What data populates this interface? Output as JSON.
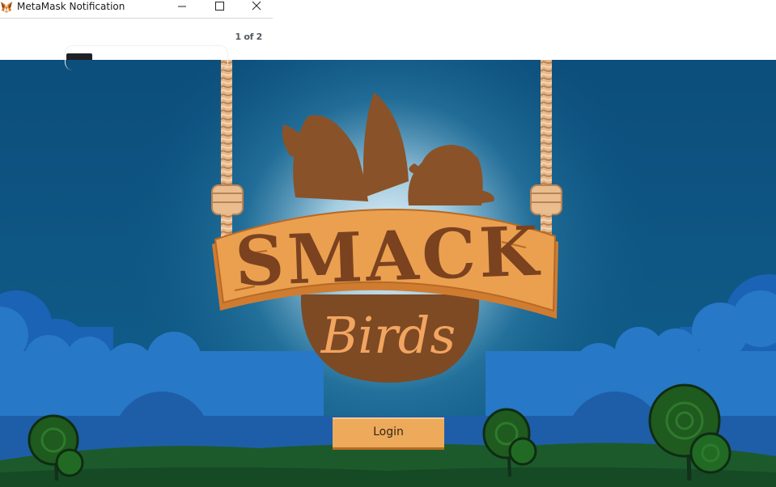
{
  "metamask_window": {
    "title": "MetaMask Notification",
    "counter": "1 of 2",
    "icon": "metamask-fox-icon",
    "controls": [
      "minimize-icon",
      "maximize-icon",
      "close-icon"
    ]
  },
  "game": {
    "title_top": "SMACK",
    "title_bottom": "Birds",
    "login_label": "Login",
    "colors": {
      "sky": "#0f5683",
      "sign_orange": "#e8984a",
      "sign_brown": "#8a4f24",
      "clouds": "#1e61b0",
      "hills": "#1d5b2c"
    }
  }
}
